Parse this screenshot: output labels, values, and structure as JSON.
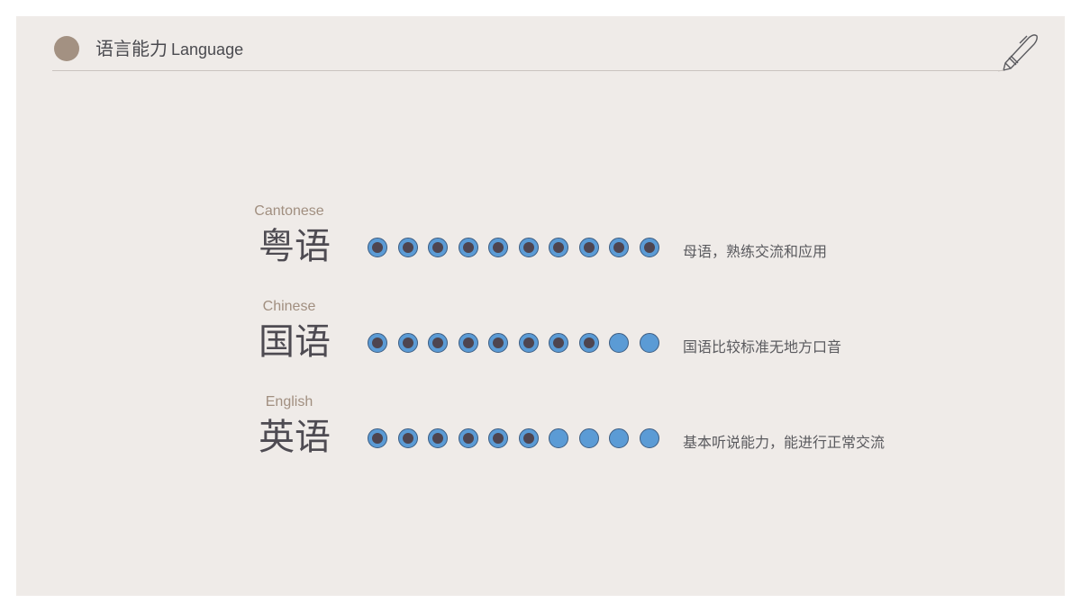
{
  "header": {
    "title_zh": "语言能力",
    "title_en": "Language",
    "decor_icon": "pen-icon"
  },
  "colors": {
    "background": "#efebe8",
    "accent": "#a39182",
    "dot_fill": "#5b9bd5",
    "dot_border": "#3d5d82",
    "dot_inner": "#4e4550"
  },
  "languages": [
    {
      "name_en": "Cantonese",
      "name_zh": "粤语",
      "level": 10,
      "max": 10,
      "description": "母语，熟练交流和应用"
    },
    {
      "name_en": "Chinese",
      "name_zh": "国语",
      "level": 8,
      "max": 10,
      "description": "国语比较标准无地方口音"
    },
    {
      "name_en": "English",
      "name_zh": "英语",
      "level": 6,
      "max": 10,
      "description": "基本听说能力，能进行正常交流"
    }
  ]
}
